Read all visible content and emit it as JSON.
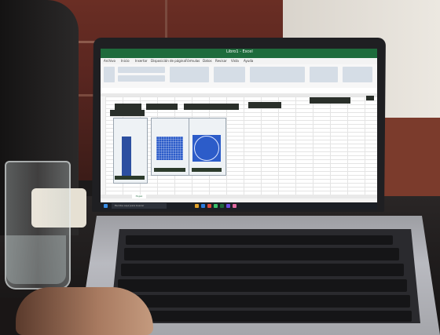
{
  "scene": {
    "description_colors": {
      "excel_green": "#1e6b3c",
      "image_blue": "#2c5cc9",
      "tile_red": "#6a2e24"
    }
  },
  "excel": {
    "title": "Libro1 - Excel",
    "ribbon_tabs": [
      "Archivo",
      "Inicio",
      "Insertar",
      "Disposición de página",
      "Fórmulas",
      "Datos",
      "Revisar",
      "Vista",
      "Ayuda"
    ],
    "sheet_tab": "Hoja1",
    "search_placeholder": "Escribe aquí para buscar"
  },
  "icons": [
    "windows-start-icon",
    "search-icon",
    "taskbar-app-icons",
    "wifi-icon",
    "volume-icon",
    "battery-icon"
  ]
}
